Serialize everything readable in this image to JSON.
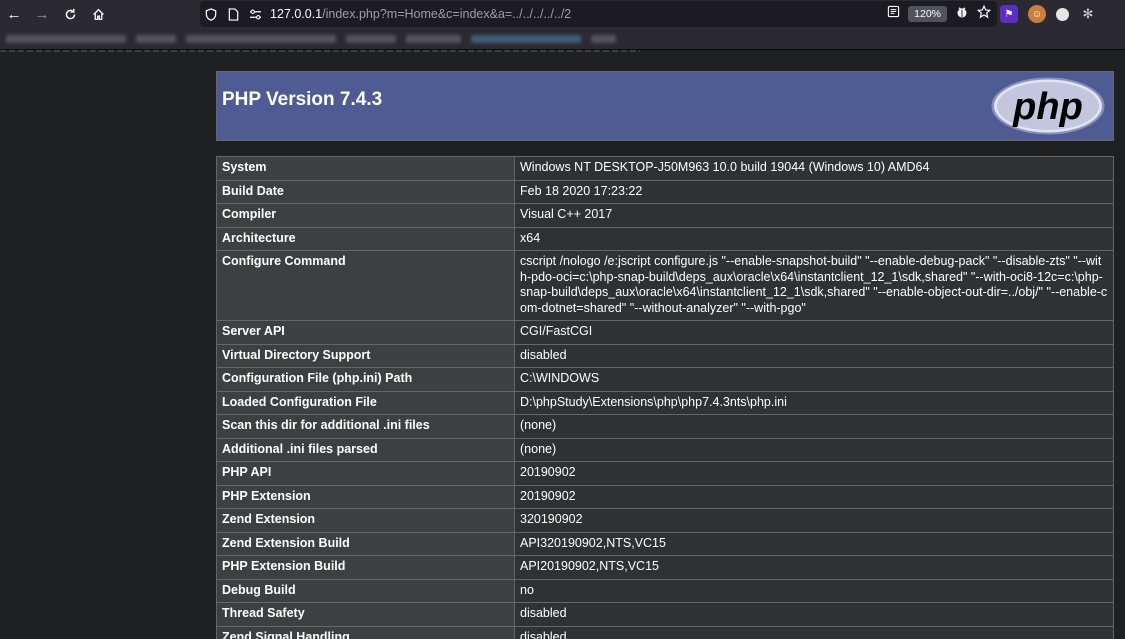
{
  "browser": {
    "url_main": "127.0.0.1",
    "url_rest": "/index.php?m=Home&c=index&a=../../../../../2",
    "zoom": "120%"
  },
  "header": {
    "title": "PHP Version 7.4.3",
    "logo_text": "php"
  },
  "rows": [
    {
      "key": "System",
      "value": "Windows NT DESKTOP-J50M963 10.0 build 19044 (Windows 10) AMD64"
    },
    {
      "key": "Build Date",
      "value": "Feb 18 2020 17:23:22"
    },
    {
      "key": "Compiler",
      "value": "Visual C++ 2017"
    },
    {
      "key": "Architecture",
      "value": "x64"
    },
    {
      "key": "Configure Command",
      "value": "cscript /nologo /e:jscript configure.js \"--enable-snapshot-build\" \"--enable-debug-pack\" \"--disable-zts\" \"--with-pdo-oci=c:\\php-snap-build\\deps_aux\\oracle\\x64\\instantclient_12_1\\sdk,shared\" \"--with-oci8-12c=c:\\php-snap-build\\deps_aux\\oracle\\x64\\instantclient_12_1\\sdk,shared\" \"--enable-object-out-dir=../obj/\" \"--enable-com-dotnet=shared\" \"--without-analyzer\" \"--with-pgo\""
    },
    {
      "key": "Server API",
      "value": "CGI/FastCGI"
    },
    {
      "key": "Virtual Directory Support",
      "value": "disabled"
    },
    {
      "key": "Configuration File (php.ini) Path",
      "value": "C:\\WINDOWS"
    },
    {
      "key": "Loaded Configuration File",
      "value": "D:\\phpStudy\\Extensions\\php\\php7.4.3nts\\php.ini"
    },
    {
      "key": "Scan this dir for additional .ini files",
      "value": "(none)"
    },
    {
      "key": "Additional .ini files parsed",
      "value": "(none)"
    },
    {
      "key": "PHP API",
      "value": "20190902"
    },
    {
      "key": "PHP Extension",
      "value": "20190902"
    },
    {
      "key": "Zend Extension",
      "value": "320190902"
    },
    {
      "key": "Zend Extension Build",
      "value": "API320190902,NTS,VC15"
    },
    {
      "key": "PHP Extension Build",
      "value": "API20190902,NTS,VC15"
    },
    {
      "key": "Debug Build",
      "value": "no"
    },
    {
      "key": "Thread Safety",
      "value": "disabled"
    },
    {
      "key": "Zend Signal Handling",
      "value": "disabled"
    }
  ],
  "icons": {
    "back": "back-arrow-icon",
    "forward": "forward-arrow-icon",
    "reload": "reload-icon",
    "home": "home-icon",
    "shield": "shield-icon",
    "page": "page-icon",
    "permissions": "permissions-icon",
    "reader": "reader-view-icon",
    "extension": "extension-icon",
    "bookmark": "bookmark-star-icon"
  },
  "colors": {
    "php_header": "#4f5b93",
    "row_key_bg": "#3e3f40",
    "row_value_bg": "#303133",
    "page_bg": "#1f2022"
  }
}
